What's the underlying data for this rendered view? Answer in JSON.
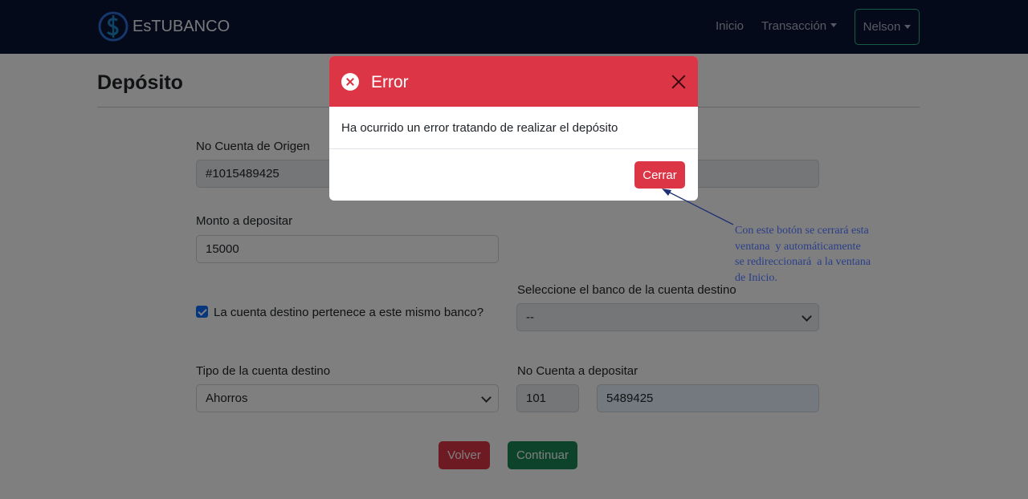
{
  "navbar": {
    "brand": "EsTUBANCO",
    "links": {
      "inicio": "Inicio",
      "transaccion": "Transacción"
    },
    "user": "Nelson"
  },
  "page": {
    "title": "Depósito",
    "origin_label": "No Cuenta de Origen",
    "origin_value": "#1015489425",
    "amount_label": "Monto a depositar",
    "amount_value": "15000",
    "same_bank_label": "La cuenta destino pertenece a este mismo banco?",
    "same_bank_checked": true,
    "bank_label": "Seleccione el banco de la cuenta destino",
    "bank_value": "--",
    "type_label": "Tipo de la cuenta destino",
    "type_value": "Ahorros",
    "account_label": "No Cuenta a depositar",
    "account_prefix": "101",
    "account_value": "5489425",
    "back_button": "Volver",
    "continue_button": "Continuar"
  },
  "modal": {
    "title": "Error",
    "message": "Ha ocurrido un error tratando de realizar el depósito",
    "close_button": "Cerrar"
  },
  "annotation": {
    "text": "Con este botón se cerrará esta\nventana  y automáticamente\nse redireccionará  a la ventana\nde Inicio."
  },
  "colors": {
    "navbar": "#0b1535",
    "danger": "#dc3545",
    "success": "#198754",
    "annotation": "#2a3f8a"
  }
}
